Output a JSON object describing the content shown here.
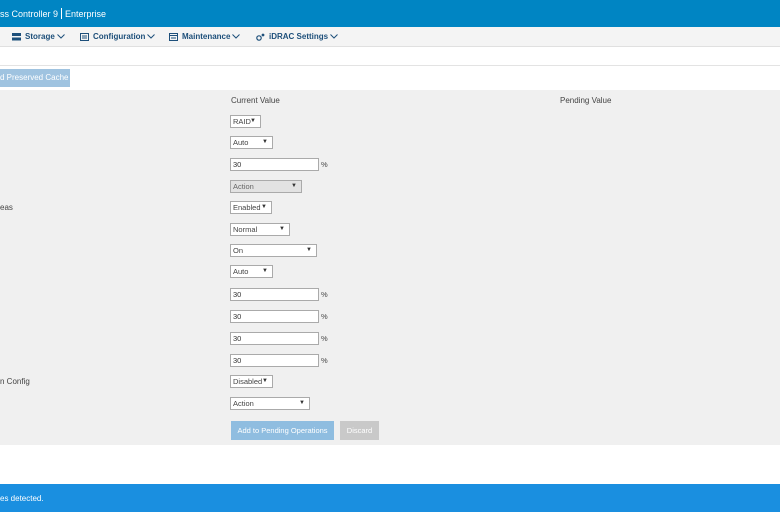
{
  "header": {
    "title_left": "ss Controller 9",
    "title_right": "Enterprise"
  },
  "nav": {
    "items": [
      {
        "label": "Storage",
        "icon": "storage-icon"
      },
      {
        "label": "Configuration",
        "icon": "configuration-icon"
      },
      {
        "label": "Maintenance",
        "icon": "maintenance-icon"
      },
      {
        "label": "iDRAC Settings",
        "icon": "idrac-settings-icon"
      }
    ]
  },
  "toolbar": {
    "preserved_cache_label": "d Preserved Cache"
  },
  "table": {
    "current_value_header": "Current Value",
    "pending_value_header": "Pending Value"
  },
  "rows": [
    {
      "label": "",
      "type": "select",
      "value": "RAID"
    },
    {
      "label": "",
      "type": "select",
      "value": "Auto"
    },
    {
      "label": "",
      "type": "input",
      "value": "30",
      "unit": "%"
    },
    {
      "label": "",
      "type": "select",
      "value": "Action",
      "disabled": true
    },
    {
      "label": "eas",
      "type": "select",
      "value": "Enabled"
    },
    {
      "label": "",
      "type": "select",
      "value": "Normal"
    },
    {
      "label": "",
      "type": "select",
      "value": "On"
    },
    {
      "label": "",
      "type": "select",
      "value": "Auto"
    },
    {
      "label": "",
      "type": "input",
      "value": "30",
      "unit": "%"
    },
    {
      "label": "",
      "type": "input",
      "value": "30",
      "unit": "%"
    },
    {
      "label": "",
      "type": "input",
      "value": "30",
      "unit": "%"
    },
    {
      "label": "",
      "type": "input",
      "value": "30",
      "unit": "%"
    },
    {
      "label": "n Config",
      "type": "select",
      "value": "Disabled"
    },
    {
      "label": "",
      "type": "select",
      "value": "Action"
    }
  ],
  "actions": {
    "add_label": "Add to Pending Operations",
    "discard_label": "Discard"
  },
  "status": {
    "message": "es detected."
  },
  "colors": {
    "header_bg": "#0085c3",
    "status_bg": "#1a8fe0",
    "button_disabled": "#8fbde0"
  }
}
